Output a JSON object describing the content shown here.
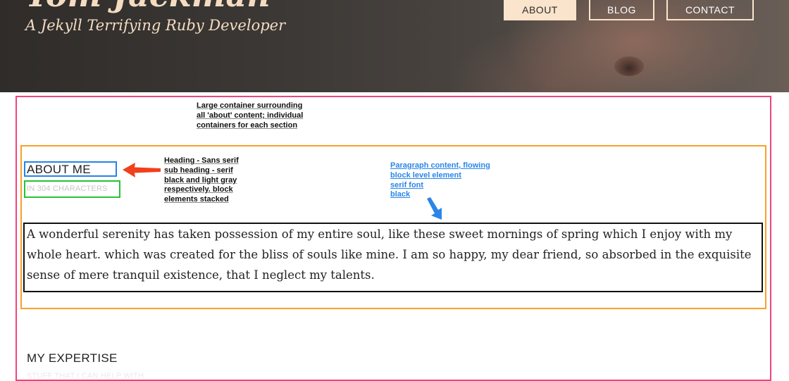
{
  "hero": {
    "name": "Tom Jackman",
    "tagline": "A Jekyll Terrifying Ruby Developer"
  },
  "nav": {
    "items": [
      {
        "label": "ABOUT",
        "active": true
      },
      {
        "label": "BLOG",
        "active": false
      },
      {
        "label": "CONTACT",
        "active": false
      }
    ]
  },
  "about": {
    "heading": "ABOUT ME",
    "subheading": "IN 304 CHARACTERS",
    "paragraph": "A wonderful serenity has taken possession of my entire soul, like these sweet mornings of spring which I enjoy with my whole heart. which was created for the bliss of souls like mine. I am so happy, my dear friend, so absorbed in the exquisite sense of mere tranquil existence, that I neglect my talents."
  },
  "expertise": {
    "heading": "MY EXPERTISE",
    "subheading": "STUFF THAT I CAN HELP WITH"
  },
  "annotations": {
    "container_note": [
      "Large container surrounding",
      "all 'about' content; individual",
      "containers for each section"
    ],
    "heading_note": [
      "Heading - Sans serif",
      "sub heading - serif",
      "black and light gray",
      "respectively. block",
      "elements stacked"
    ],
    "paragraph_note": [
      "Paragraph content, flowing",
      "block level element",
      "serif font",
      "black"
    ]
  },
  "colors": {
    "nav_accent": "#fbe4cc",
    "annotation_pink": "#f0437f",
    "annotation_orange": "#f8a12a",
    "annotation_blue": "#2584e6",
    "annotation_green": "#27c335",
    "arrow_red": "#f0401c",
    "arrow_blue": "#2a86e8"
  }
}
